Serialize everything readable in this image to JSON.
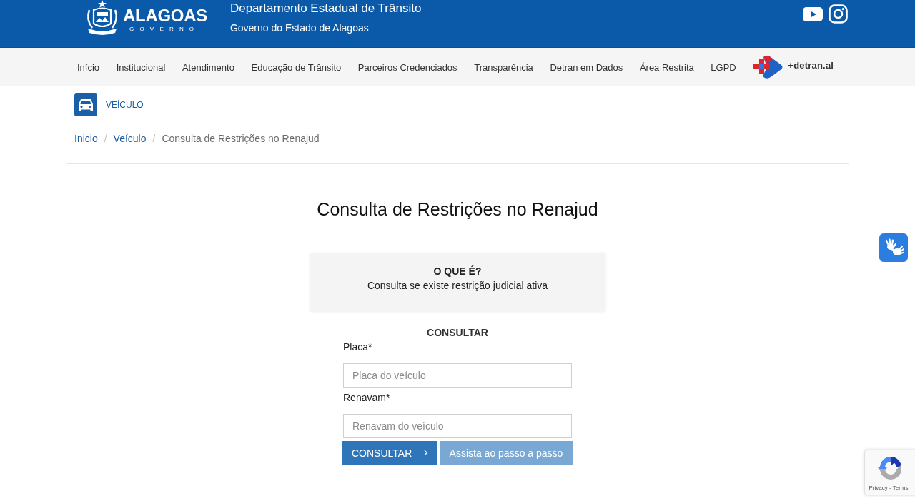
{
  "header": {
    "logo": {
      "name": "ALAGOAS",
      "tagline": "GOVERNO"
    },
    "title": "Departamento Estadual de Trânsito",
    "subtitle": "Governo do Estado de Alagoas"
  },
  "nav": {
    "items": [
      "Início",
      "Institucional",
      "Atendimento",
      "Educação de Trânsito",
      "Parceiros Credenciados",
      "Transparência",
      "Detran em Dados",
      "Área Restrita",
      "LGPD"
    ],
    "brand": "+detran.al"
  },
  "section": {
    "label": "VEÍCULO"
  },
  "breadcrumb": [
    {
      "kind": "link",
      "label": "Inicio"
    },
    {
      "kind": "separator",
      "label": "/"
    },
    {
      "kind": "link",
      "label": "Veículo"
    },
    {
      "kind": "separator",
      "label": "/"
    },
    {
      "kind": "current",
      "label": "Consulta de Restrições no Renajud"
    }
  ],
  "page_title": "Consulta de Restrições no Renajud",
  "info_card": {
    "heading": "O QUE É?",
    "text": "Consulta se existe restrição judicial ativa"
  },
  "form": {
    "heading": "CONSULTAR",
    "fields": [
      {
        "label": "Placa*",
        "placeholder": "Placa do veículo"
      },
      {
        "label": "Renavam*",
        "placeholder": "Renavam do veículo"
      }
    ],
    "buttons": [
      {
        "kind": "primary",
        "label": "CONSULTAR"
      },
      {
        "kind": "secondary",
        "label": "Assista ao passo a passo"
      }
    ]
  },
  "recaptcha": {
    "links": "Privacy - Terms"
  }
}
